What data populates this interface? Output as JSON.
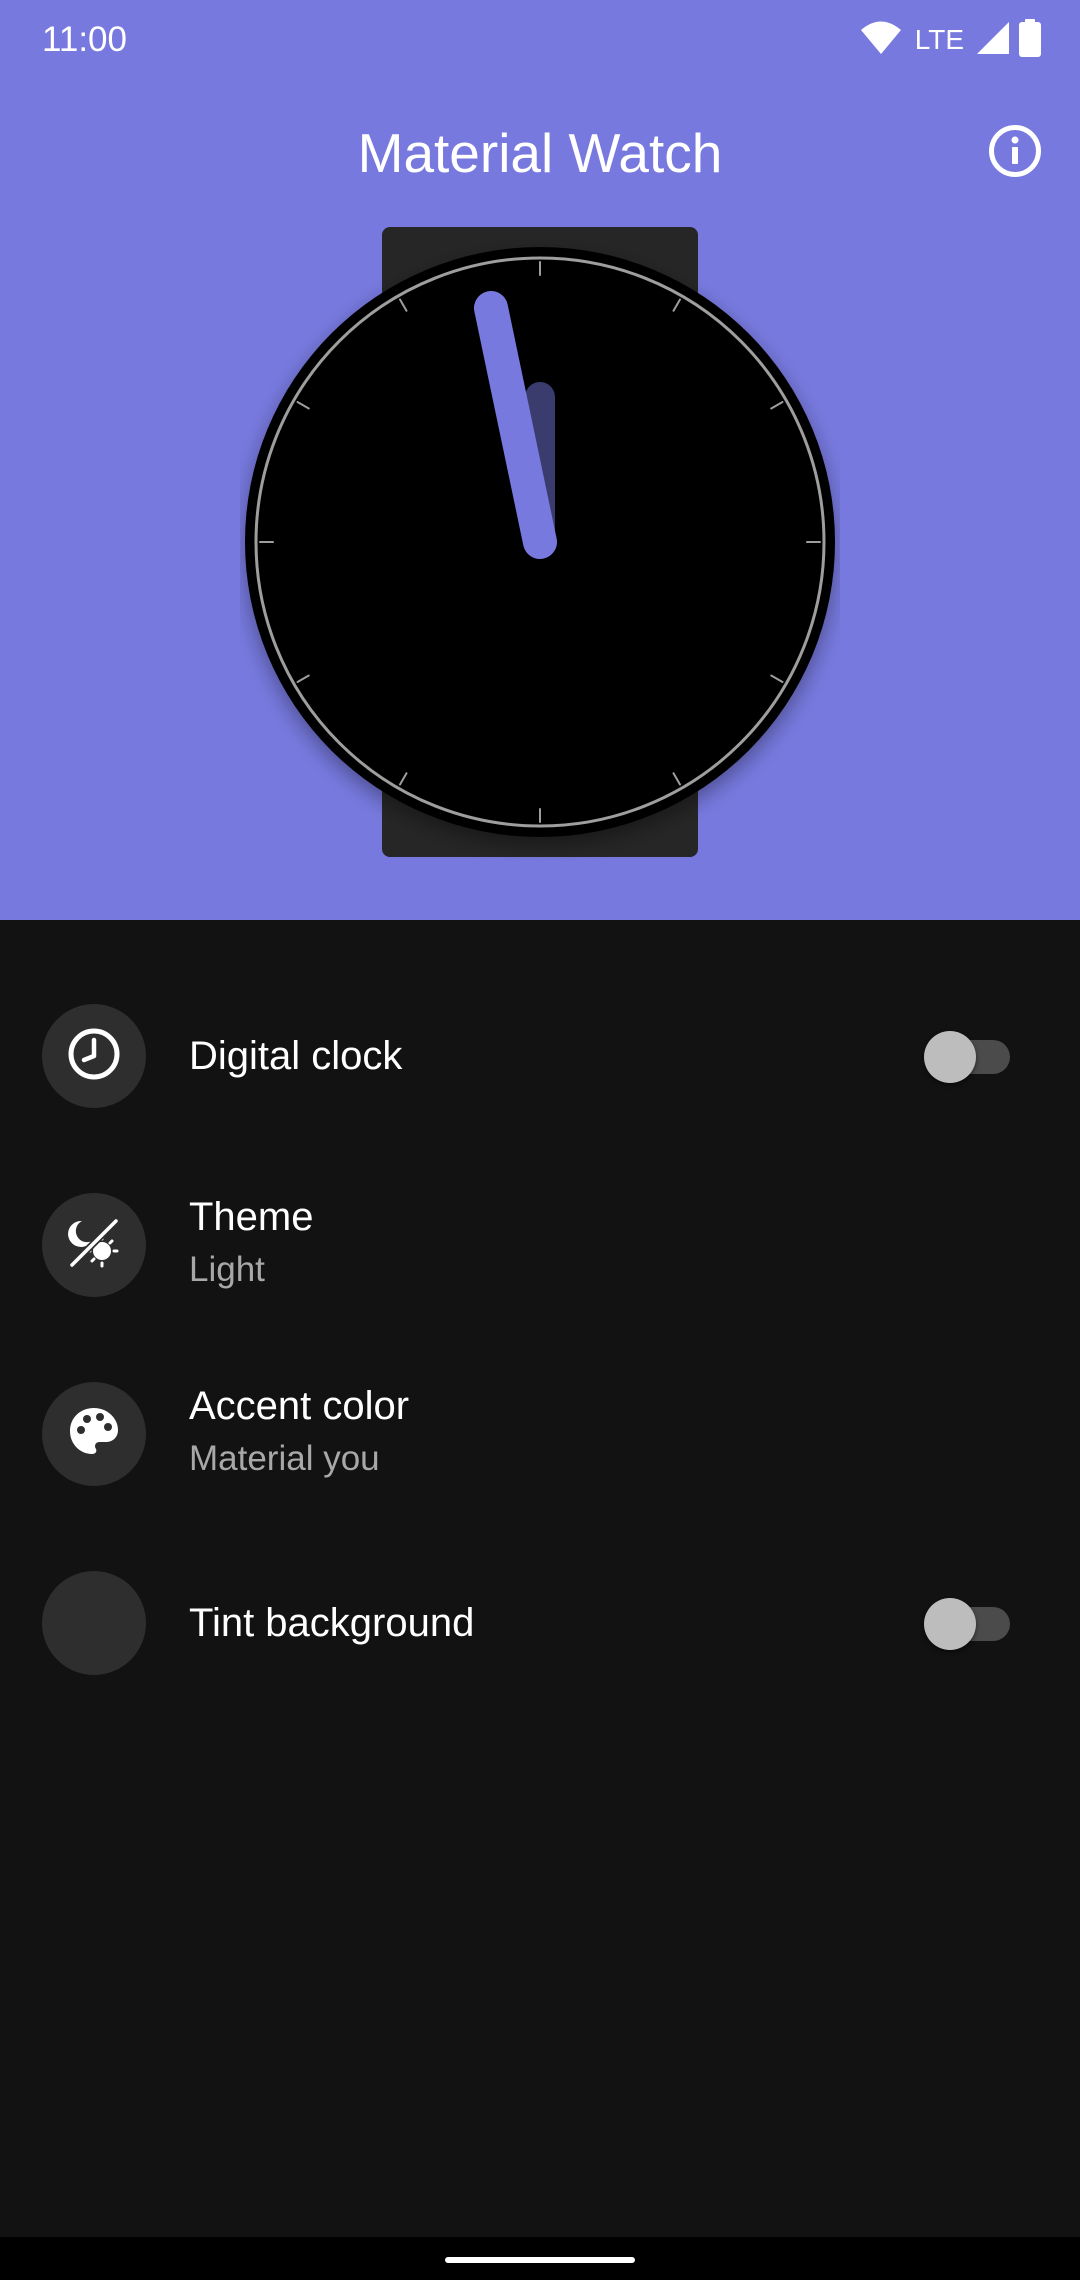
{
  "status_bar": {
    "time": "11:00",
    "network_label": "LTE",
    "icons": [
      "wifi-icon",
      "cell-signal-icon",
      "battery-icon"
    ]
  },
  "header": {
    "title": "Material Watch",
    "info_icon": "info-icon"
  },
  "watch_face": {
    "time_shown": "11:00",
    "colors": {
      "accent": "#7779de",
      "face": "#000000",
      "band": "#262626"
    }
  },
  "settings": [
    {
      "icon": "clock-icon",
      "title": "Digital clock",
      "subtitle": "",
      "toggle": false
    },
    {
      "icon": "theme-icon",
      "title": "Theme",
      "subtitle": "Light"
    },
    {
      "icon": "palette-icon",
      "title": "Accent color",
      "subtitle": "Material you"
    },
    {
      "icon": "",
      "title": "Tint background",
      "subtitle": "",
      "toggle": false
    }
  ],
  "colors": {
    "header_bg": "#7779de",
    "content_bg": "#121212",
    "icon_circle": "#2e2e2e",
    "subtitle_text": "#a8a8a8"
  }
}
